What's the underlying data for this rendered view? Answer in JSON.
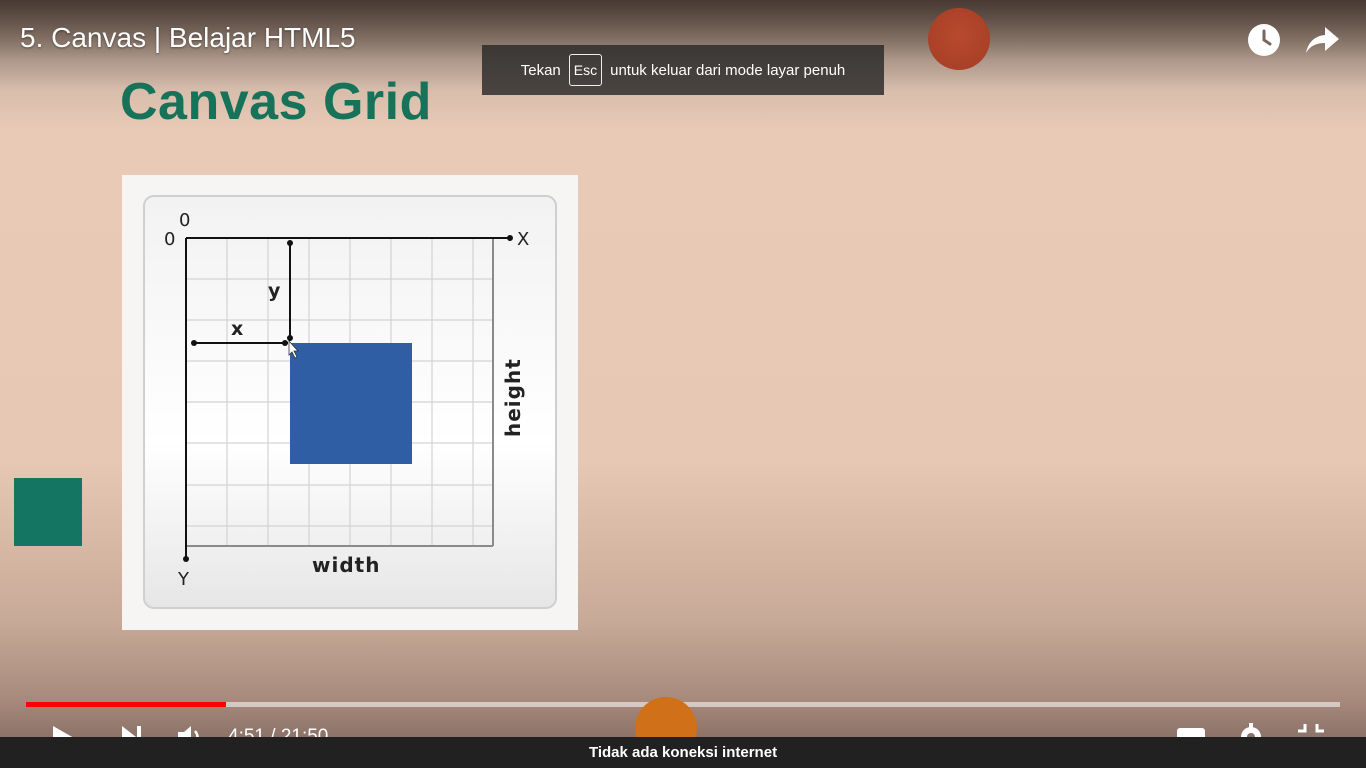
{
  "player": {
    "title": "5. Canvas | Belajar HTML5",
    "watch_later_icon": "clock-icon",
    "share_icon": "share-icon",
    "time_current": "4:51",
    "time_total": "21:50",
    "time_text": "4:51 / 21:50",
    "progress_fraction": 0.152,
    "progress_color": "#ff0000"
  },
  "fullscreen_toast": {
    "prefix": "Tekan",
    "key": "Esc",
    "suffix": "untuk keluar dari mode layar penuh"
  },
  "slide": {
    "heading": "Canvas Grid",
    "heading_color": "#16735a",
    "diagram": {
      "origin_top": "0",
      "origin_left": "0",
      "x_axis": "X",
      "y_axis": "Y",
      "x_label": "x",
      "y_label": "y",
      "width_label": "width",
      "height_label": "height",
      "rect_color": "#2f5ea5"
    }
  },
  "status_bar": {
    "message": "Tidak ada koneksi internet"
  }
}
